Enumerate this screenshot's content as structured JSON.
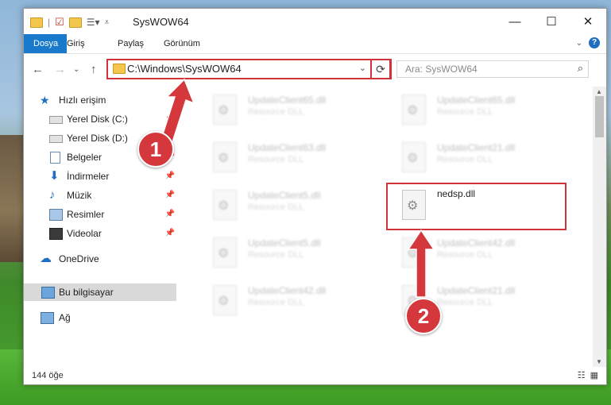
{
  "window": {
    "title": "SysWOW64",
    "caption": {
      "minimize": "—",
      "maximize": "☐",
      "close": "✕"
    }
  },
  "ribbon": {
    "tabs": [
      "Dosya",
      "Giriş",
      "Paylaş",
      "Görünüm"
    ],
    "help": "?"
  },
  "nav": {
    "address": "C:\\Windows\\SysWOW64",
    "search_placeholder": "Ara: SysWOW64"
  },
  "sidebar": {
    "items": [
      {
        "label": "Hızlı erişim",
        "icon": "star-icon"
      },
      {
        "label": "Yerel Disk (C:)",
        "icon": "drive-icon"
      },
      {
        "label": "Yerel Disk (D:)",
        "icon": "drive-icon"
      },
      {
        "label": "Belgeler",
        "icon": "documents-icon"
      },
      {
        "label": "İndirmeler",
        "icon": "downloads-icon"
      },
      {
        "label": "Müzik",
        "icon": "music-icon"
      },
      {
        "label": "Resimler",
        "icon": "pictures-icon"
      },
      {
        "label": "Videolar",
        "icon": "videos-icon"
      },
      {
        "label": "OneDrive",
        "icon": "cloud-icon"
      },
      {
        "label": "Bu bilgisayar",
        "icon": "computer-icon"
      },
      {
        "label": "Ağ",
        "icon": "network-icon"
      }
    ]
  },
  "files": [
    {
      "name": "UpdateClient65.dll",
      "type": "Resource DLL"
    },
    {
      "name": "UpdateClient65.dll",
      "type": "Resource DLL"
    },
    {
      "name": "UpdateClient63.dll",
      "type": "Resource DLL"
    },
    {
      "name": "UpdateClient21.dll",
      "type": "Resource DLL"
    },
    {
      "name": "UpdateClient5.dll",
      "type": "Resource DLL"
    },
    {
      "name": "nedsp.dll",
      "type": ""
    },
    {
      "name": "UpdateClient5.dll",
      "type": "Resource DLL"
    },
    {
      "name": "UpdateClient42.dll",
      "type": "Resource DLL"
    },
    {
      "name": "UpdateClient42.dll",
      "type": "Resource DLL"
    },
    {
      "name": "UpdateClient21.dll",
      "type": "Resource DLL"
    }
  ],
  "status": {
    "count": "144 öğe"
  },
  "annotations": {
    "step1": "1",
    "step2": "2"
  },
  "colors": {
    "accent": "#1979ca",
    "highlight": "#d0343a"
  }
}
